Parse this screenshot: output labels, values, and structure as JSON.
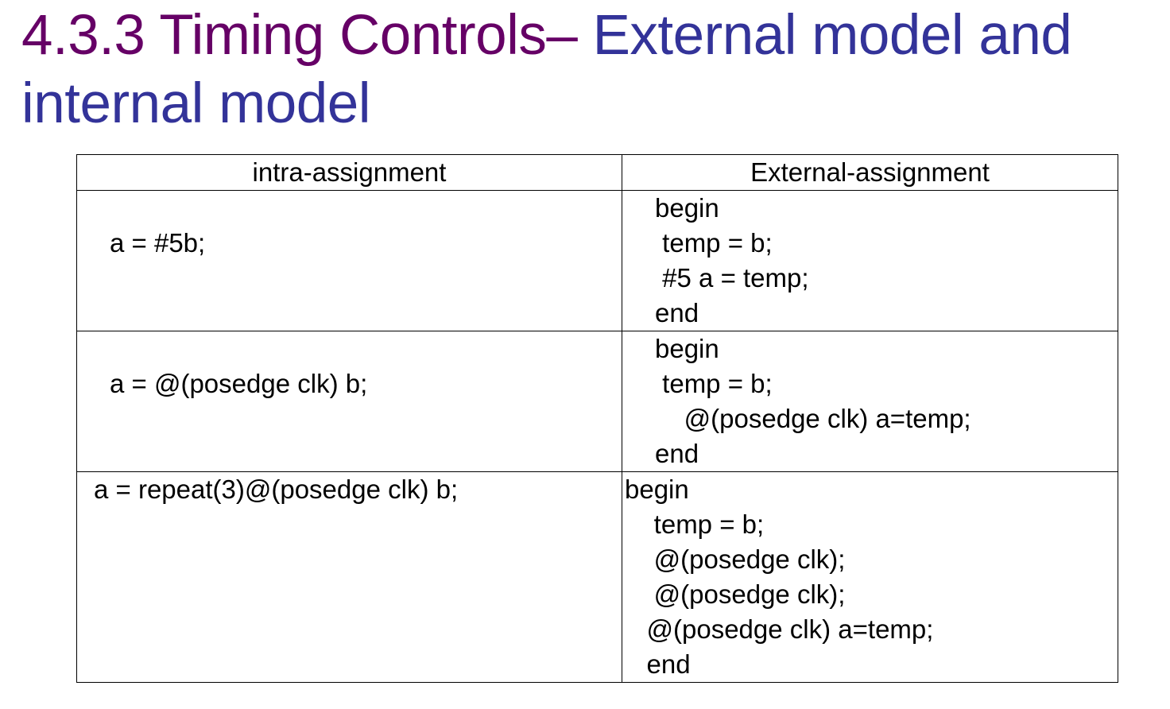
{
  "title": {
    "part1": "4.3.3 Timing Controls– ",
    "part2": "External model and internal model",
    "colors": {
      "part1": "#660066",
      "part2": "#333399"
    }
  },
  "table": {
    "headers": [
      "intra-assignment",
      "External-assignment"
    ],
    "rows": [
      {
        "intra": "a = #5b;",
        "external": [
          "begin",
          " temp = b;",
          " #5 a = temp;",
          "end"
        ]
      },
      {
        "intra": "a = @(posedge clk) b;",
        "external": [
          "begin",
          " temp = b;",
          "    @(posedge clk) a=temp;",
          "end"
        ]
      },
      {
        "intra": "a = repeat(3)@(posedge clk) b;",
        "external": [
          "begin",
          "    temp = b;",
          "    @(posedge clk);",
          "    @(posedge clk);",
          "   @(posedge clk) a=temp;",
          "   end"
        ]
      }
    ]
  }
}
